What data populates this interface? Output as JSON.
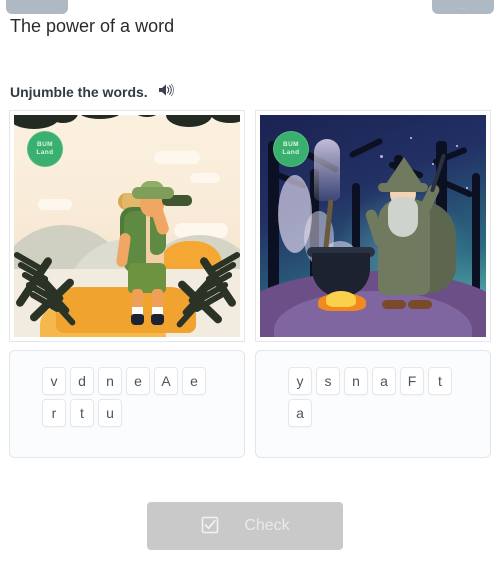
{
  "window": {
    "top_left_chip": "",
    "top_right_chip": "..."
  },
  "header": {
    "title": "The power of a word"
  },
  "task": {
    "instruction": "Unjumble the words.",
    "audio_icon": "speaker-icon"
  },
  "exercise": {
    "cards": [
      {
        "image": {
          "alt": "explorer-with-binoculars-illustration",
          "badge_line1": "BUM",
          "badge_line2": "Land",
          "badge_color": "#39b06d"
        },
        "letters": [
          "v",
          "d",
          "n",
          "e",
          "A",
          "e",
          "r",
          "t",
          "u"
        ]
      },
      {
        "image": {
          "alt": "wizard-with-cauldron-illustration",
          "badge_line1": "BUM",
          "badge_line2": "Land",
          "badge_color": "#39b06d"
        },
        "letters": [
          "y",
          "s",
          "n",
          "a",
          "F",
          "t",
          "a"
        ]
      }
    ]
  },
  "footer": {
    "check_label": "Check",
    "check_icon": "checkbox-icon",
    "check_disabled_color": "#c9c9c9"
  }
}
